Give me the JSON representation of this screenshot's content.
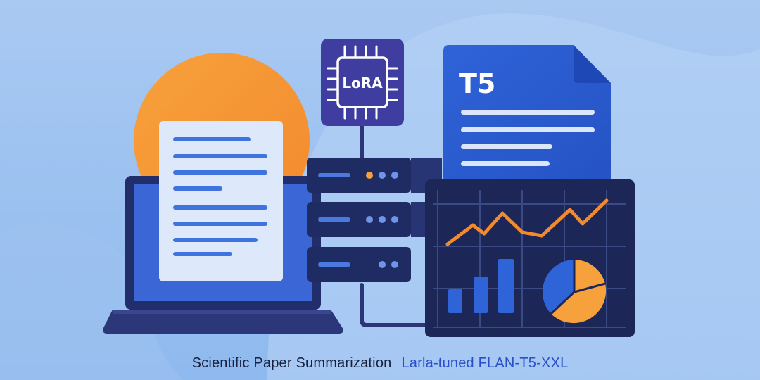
{
  "illustration": {
    "chip_label": "LoRA",
    "document_label": "T5",
    "colors": {
      "background_top": "#a9c9f2",
      "background_bottom": "#7fb0ea",
      "accent_orange": "#f7a13c",
      "primary_blue": "#2f63d8",
      "dark_navy": "#1f2c63",
      "chip_purple": "#3f3ea0",
      "paper_light": "#dde8fa"
    },
    "icons": [
      "laptop-icon",
      "document-icon",
      "server-icon",
      "chip-icon",
      "dashboard-icon",
      "line-chart-icon",
      "bar-chart-icon",
      "pie-chart-icon",
      "sun-icon"
    ]
  },
  "caption": {
    "left": "Scientific Paper Summarization",
    "right": "Larla-tuned FLAN-T5-XXL"
  }
}
